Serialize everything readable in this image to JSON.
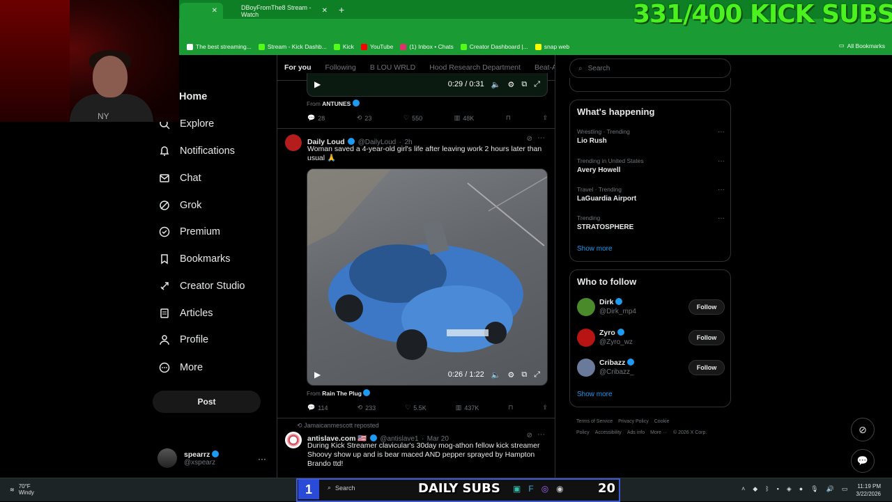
{
  "browser": {
    "tabs": [
      {
        "title": "",
        "active": true
      },
      {
        "title": "DBoyFromThe8 Stream - Watch",
        "active": false
      }
    ],
    "bookmarks": [
      {
        "label": "The best streaming...",
        "color": "#ffffff"
      },
      {
        "label": "Stream - Kick Dashb...",
        "color": "#53fc18"
      },
      {
        "label": "Kick",
        "color": "#53fc18"
      },
      {
        "label": "YouTube",
        "color": "#ff0000"
      },
      {
        "label": "(1) Inbox • Chats",
        "color": "#e1306c"
      },
      {
        "label": "Creator Dashboard |...",
        "color": "#53fc18"
      },
      {
        "label": "snap web",
        "color": "#fffc00"
      }
    ],
    "all_bookmarks": "All Bookmarks"
  },
  "overlay": {
    "subs_goal": "331/400 KICK SUBS",
    "daily_label": "DAILY SUBS",
    "daily_count": "20",
    "start_number": "1"
  },
  "nav": {
    "items": [
      {
        "label": "Home",
        "icon": "home-icon"
      },
      {
        "label": "Explore",
        "icon": "search-icon"
      },
      {
        "label": "Notifications",
        "icon": "bell-icon"
      },
      {
        "label": "Chat",
        "icon": "mail-icon"
      },
      {
        "label": "Grok",
        "icon": "grok-icon"
      },
      {
        "label": "Premium",
        "icon": "premium-icon"
      },
      {
        "label": "Bookmarks",
        "icon": "bookmark-icon"
      },
      {
        "label": "Creator Studio",
        "icon": "rocket-icon"
      },
      {
        "label": "Articles",
        "icon": "article-icon"
      },
      {
        "label": "Profile",
        "icon": "person-icon"
      },
      {
        "label": "More",
        "icon": "more-icon"
      }
    ],
    "post_label": "Post",
    "account": {
      "name": "spearrz",
      "handle": "@xspearz"
    }
  },
  "feed": {
    "tabs": [
      "For you",
      "Following",
      "B LOU WRLD",
      "Hood Research Department",
      "Beat-A"
    ],
    "tweet1": {
      "video_time": "0:29 / 0:31",
      "from_label": "From",
      "from_name": "ANTUNES",
      "replies": "28",
      "reposts": "23",
      "likes": "550",
      "views": "48K"
    },
    "tweet2": {
      "name": "Daily Loud",
      "handle": "@DailyLoud",
      "time": "2h",
      "text": "Woman saved a 4-year-old girl's life after leaving work 2 hours later than usual 🙏",
      "video_time": "0:26 / 1:22",
      "from_label": "From",
      "from_name": "Rain The Plug",
      "replies": "114",
      "reposts": "233",
      "likes": "5.5K",
      "views": "437K"
    },
    "tweet3": {
      "repost_note": "Jamaicanmescott reposted",
      "name": "antislave.com 🇺🇸",
      "handle": "@antislave1",
      "time": "Mar 20",
      "text": "During Kick Streamer clavicular's 30day mog-athon fellow kick streamer Shoovy show up and is bear maced AND pepper sprayed by Hampton Brando ttd!"
    }
  },
  "right": {
    "search_placeholder": "Search",
    "happening_title": "What's happening",
    "trends": [
      {
        "context": "Wrestling · Trending",
        "topic": "Lio Rush"
      },
      {
        "context": "Trending in United States",
        "topic": "Avery Howell"
      },
      {
        "context": "Travel · Trending",
        "topic": "LaGuardia Airport"
      },
      {
        "context": "Trending",
        "topic": "STRATOSPHERE"
      }
    ],
    "show_more": "Show more",
    "follow_title": "Who to follow",
    "follow": [
      {
        "name": "Dirk",
        "handle": "@Dirk_mp4",
        "color": "#4a8a2a"
      },
      {
        "name": "Zyro",
        "handle": "@Zyro_wz",
        "color": "#b81414"
      },
      {
        "name": "Cribazz",
        "handle": "@Cribazz_",
        "color": "#6a7a9a"
      }
    ],
    "follow_label": "Follow",
    "footer": [
      "Terms of Service",
      "Privacy Policy",
      "Cookie Policy",
      "Accessibility",
      "Ads info",
      "More ···",
      "© 2026 X Corp."
    ]
  },
  "taskbar": {
    "temp": "70°F",
    "weather": "Windy",
    "search": "Search",
    "time": "11:19 PM",
    "date": "3/22/2026"
  }
}
